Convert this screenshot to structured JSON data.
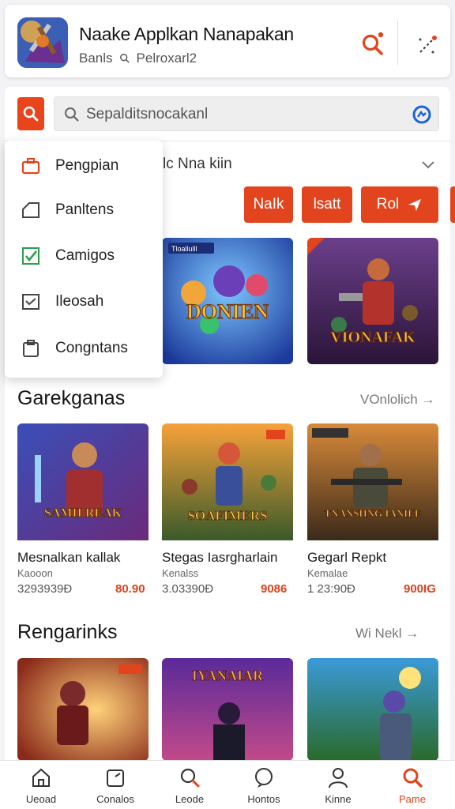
{
  "header": {
    "app_title": "Naake Applkan Nanapakan",
    "subtitle_left": "Banls",
    "subtitle_right": "Pelroxarl2"
  },
  "search": {
    "placeholder": "Sepalditsnocakanl"
  },
  "dropdown": {
    "items": [
      {
        "label": "Pengpian",
        "icon": "briefcase-icon"
      },
      {
        "label": "Panltens",
        "icon": "tag-icon"
      },
      {
        "label": "Camigos",
        "icon": "checkbox-icon"
      },
      {
        "label": "Ileosah",
        "icon": "chart-icon"
      },
      {
        "label": "Congntans",
        "icon": "clipboard-icon"
      }
    ]
  },
  "sort": {
    "label": "lc Nna kiin"
  },
  "chips": [
    "NaIk",
    "lsatt",
    "Rol"
  ],
  "featured": [
    {
      "art_text": "DONIEN",
      "badge": "Tloallulll"
    },
    {
      "art_text": "VIONAFAK",
      "badge": ""
    }
  ],
  "section1": {
    "title": "Garekganas",
    "link": "VOnlolich →",
    "items": [
      {
        "title": "Mesnalkan kallak",
        "meta": "Kaooon",
        "count": "3293939Ð",
        "price": "80.90",
        "art_text": "SAMII REAK"
      },
      {
        "title": "Stegas Iasrgharlain",
        "meta": "Kenalss",
        "count": "3.03390Ð",
        "price": "9086",
        "art_text": "SOAFIMERS"
      },
      {
        "title": "Gegarl Repkt",
        "meta": "Kemalae",
        "count": "1 23:90Ð",
        "price": "900IG",
        "art_text": "TNANSHNG IANIEE"
      }
    ]
  },
  "section2": {
    "title": "Rengarinks",
    "link": "Wi Nekl →",
    "items": [
      {
        "art_text": ""
      },
      {
        "art_text": "IYANAIAR"
      },
      {
        "art_text": ""
      }
    ]
  },
  "bottom_nav": [
    {
      "label": "Ueoad",
      "icon": "home-icon"
    },
    {
      "label": "Conalos",
      "icon": "folder-icon"
    },
    {
      "label": "Leode",
      "icon": "search-icon"
    },
    {
      "label": "Hontos",
      "icon": "chat-icon"
    },
    {
      "label": "Kinne",
      "icon": "profile-icon"
    },
    {
      "label": "Pame",
      "icon": "search-icon"
    }
  ],
  "colors": {
    "accent": "#e2451d",
    "price": "#e1401a",
    "lens_blue": "#1a63d8"
  }
}
